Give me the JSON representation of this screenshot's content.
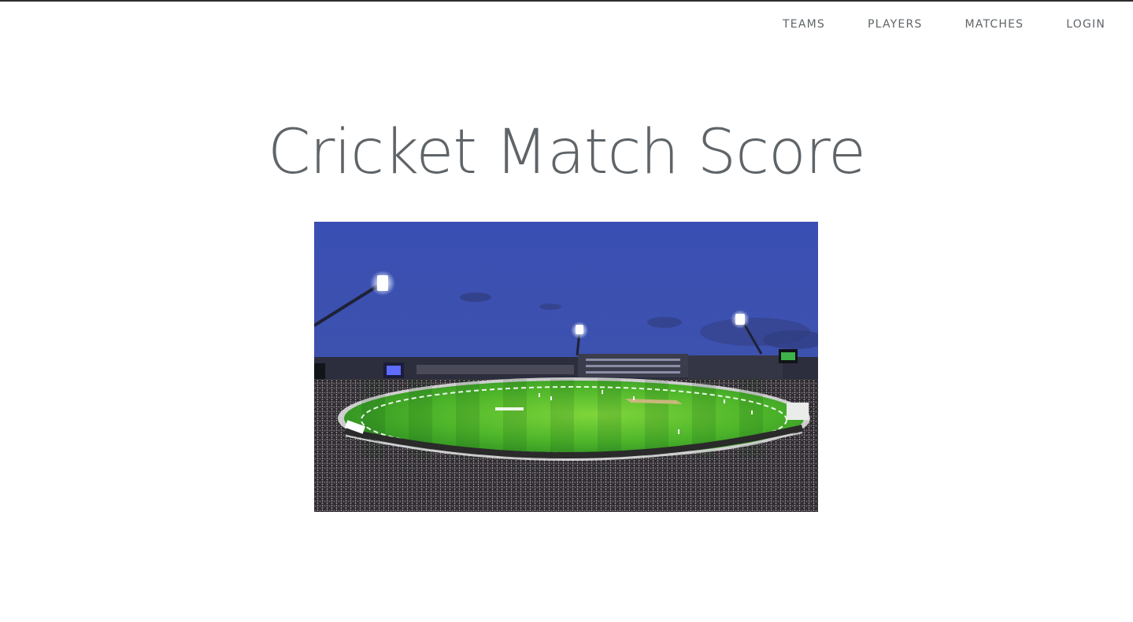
{
  "nav": {
    "items": [
      {
        "label": "TEAMS"
      },
      {
        "label": "PLAYERS"
      },
      {
        "label": "MATCHES"
      },
      {
        "label": "LOGIN"
      }
    ]
  },
  "page": {
    "title": "Cricket Match Score"
  },
  "colors": {
    "text": "#5f6468",
    "topline": "#2c2c2c",
    "sky": "#3b4fb0",
    "field": "#45b92a"
  }
}
